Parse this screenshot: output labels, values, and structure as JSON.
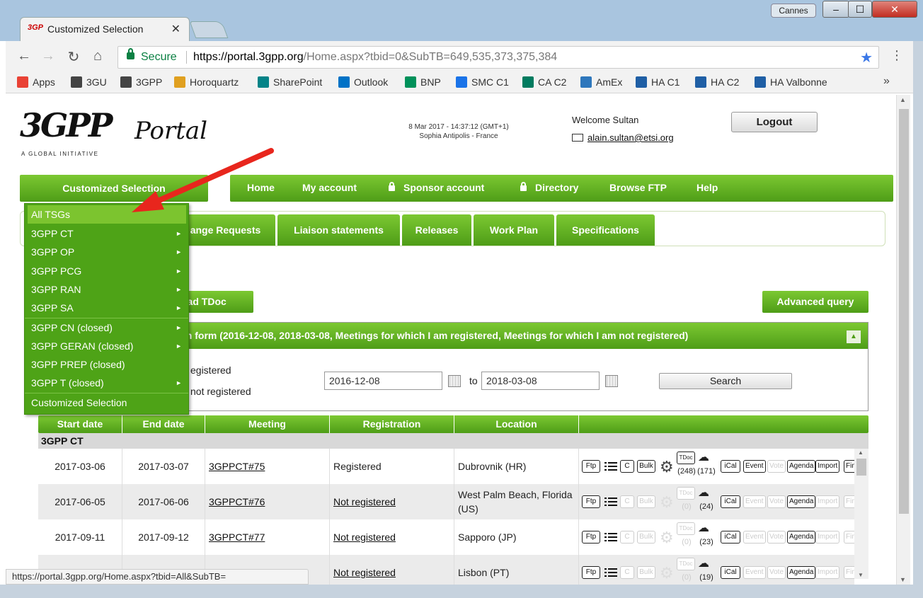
{
  "browser": {
    "tab_title": "Customized Selection",
    "tab_close": "✕",
    "profile": "Cannes",
    "win_min": "–",
    "win_max": "☐",
    "win_close": "✕",
    "secure_label": "Secure",
    "url_scheme_host": "https://portal.3gpp.org",
    "url_path": "/Home.aspx?tbid=0&SubTB=649,535,373,375,384",
    "bookmarks": [
      {
        "label": "Apps",
        "icon": "apps-grid-icon",
        "color": "#e94235"
      },
      {
        "label": "3GU",
        "icon": "3gpp-logo-icon",
        "color": "#444444"
      },
      {
        "label": "3GPP",
        "icon": "3gpp-logo-icon",
        "color": "#444444"
      },
      {
        "label": "Horoquartz",
        "icon": "horoquartz-icon",
        "color": "#e0a020"
      },
      {
        "label": "SharePoint",
        "icon": "sharepoint-icon",
        "color": "#038387"
      },
      {
        "label": "Outlook",
        "icon": "outlook-icon",
        "color": "#0072c6"
      },
      {
        "label": "BNP",
        "icon": "bnp-icon",
        "color": "#00915a"
      },
      {
        "label": "SMC C1",
        "icon": "star-icon",
        "color": "#1a73e8"
      },
      {
        "label": "CA C2",
        "icon": "ca-icon",
        "color": "#007b5f"
      },
      {
        "label": "AmEx",
        "icon": "amex-icon",
        "color": "#2e77bc"
      },
      {
        "label": "HA C1",
        "icon": "ha-icon",
        "color": "#1f5fa5"
      },
      {
        "label": "HA C2",
        "icon": "ha-icon",
        "color": "#1f5fa5"
      },
      {
        "label": "HA Valbonne",
        "icon": "ha-icon",
        "color": "#1f5fa5"
      }
    ],
    "bookmarks_more": "»",
    "status_url": "https://portal.3gpp.org/Home.aspx?tbid=All&SubTB="
  },
  "header": {
    "logo_3gpp": "3GPP",
    "logo_sub": "A GLOBAL INITIATIVE",
    "logo_portal": "Portal",
    "date": "8 Mar 2017 - 14:37:12 (GMT+1)",
    "place": "Sophia Antipolis - France",
    "welcome": "Welcome Sultan",
    "email": "alain.sultan@etsi.org",
    "logout": "Logout"
  },
  "nav": {
    "customized": "Customized Selection",
    "items": [
      "Home",
      "My account",
      "Sponsor account",
      "Directory",
      "Browse FTP",
      "Help"
    ]
  },
  "subtabs": [
    "ange Requests",
    "Liaison statements",
    "Releases",
    "Work Plan",
    "Specifications"
  ],
  "buttons": {
    "upload": "oad TDoc",
    "advanced": "Advanced query"
  },
  "search": {
    "header": "ch form (2016-12-08, 2018-03-08, Meetings for which I am registered, Meetings for which I am not registered)",
    "option1": "egistered",
    "option2": "not registered",
    "from": "2016-12-08",
    "to_label": "to",
    "to": "2018-03-08",
    "button": "Search"
  },
  "dropdown": {
    "items": [
      {
        "label": "All TSGs",
        "arrow": ""
      },
      {
        "label": "3GPP CT",
        "arrow": "►"
      },
      {
        "label": "3GPP OP",
        "arrow": "►"
      },
      {
        "label": "3GPP PCG",
        "arrow": "►"
      },
      {
        "label": "3GPP RAN",
        "arrow": "►"
      },
      {
        "label": "3GPP SA",
        "arrow": "►"
      },
      {
        "label": "3GPP CN (closed)",
        "arrow": "►"
      },
      {
        "label": "3GPP GERAN (closed)",
        "arrow": "►"
      },
      {
        "label": "3GPP PREP (closed)",
        "arrow": ""
      },
      {
        "label": "3GPP T (closed)",
        "arrow": "►"
      },
      {
        "label": "Customized Selection",
        "arrow": ""
      }
    ]
  },
  "table": {
    "headers": [
      "Start date",
      "End date",
      "Meeting",
      "Registration",
      "Location"
    ],
    "group": "3GPP CT",
    "tool_labels": {
      "ftp": "Ftp",
      "c": "C",
      "bulk": "Bulk",
      "tdoc": "TDoc",
      "ical": "iCal",
      "event": "Event",
      "vote": "Vote",
      "agenda": "Agenda",
      "import": "Import",
      "fin": "Fin"
    },
    "rows": [
      {
        "start": "2017-03-06",
        "end": "2017-03-07",
        "meeting": "3GPPCT#75",
        "registration": "Registered",
        "reg_link": false,
        "location": "Dubrovnik (HR)",
        "tdoc_count": "(248)",
        "people_count": "(171)",
        "active": true
      },
      {
        "start": "2017-06-05",
        "end": "2017-06-06",
        "meeting": "3GPPCT#76",
        "registration": "Not registered",
        "reg_link": true,
        "location": "West Palm Beach, Florida (US)",
        "tdoc_count": "(0)",
        "people_count": "(24)",
        "active": false
      },
      {
        "start": "2017-09-11",
        "end": "2017-09-12",
        "meeting": "3GPPCT#77",
        "registration": "Not registered",
        "reg_link": true,
        "location": "Sapporo (JP)",
        "tdoc_count": "(0)",
        "people_count": "(23)",
        "active": false
      },
      {
        "start": "",
        "end": "",
        "meeting": "",
        "registration": "Not registered",
        "reg_link": true,
        "location": "Lisbon (PT)",
        "tdoc_count": "(0)",
        "people_count": "(19)",
        "active": false
      }
    ]
  },
  "colors": {
    "green_light": "#7cc832",
    "green_dark": "#4e9d17",
    "arrow_red": "#e8261d",
    "link_blue": "#3b78e7"
  }
}
